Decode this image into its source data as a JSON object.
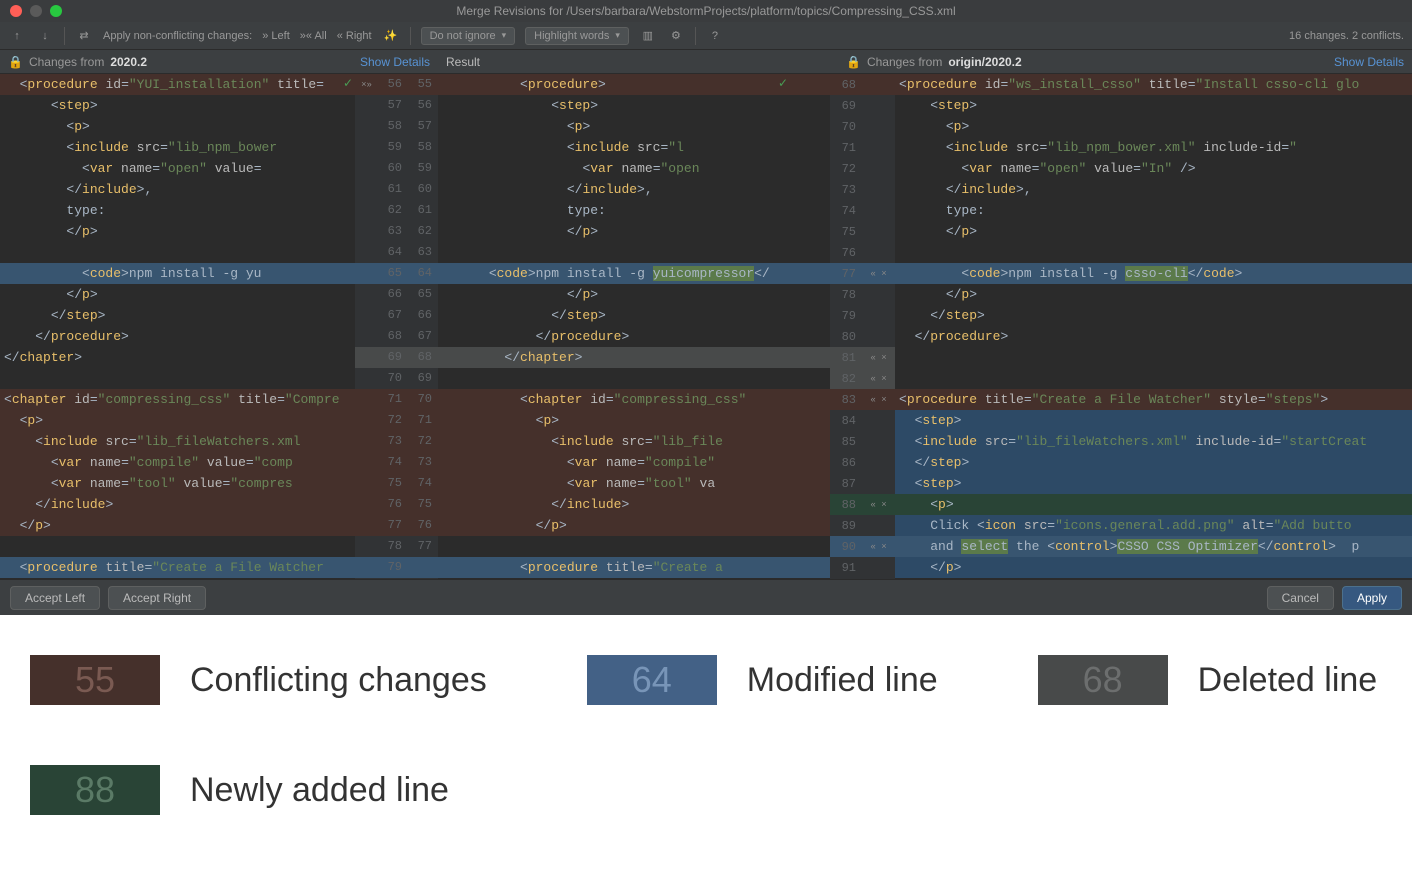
{
  "titlebar": "Merge Revisions for /Users/barbara/WebstormProjects/platform/topics/Compressing_CSS.xml",
  "toolbar": {
    "apply_label": "Apply non-conflicting changes:",
    "left": "Left",
    "all": "All",
    "right": "Right",
    "ignore_dd": "Do not ignore",
    "highlight_dd": "Highlight words",
    "status": "16 changes. 2 conflicts."
  },
  "panels": {
    "left_prefix": "Changes from ",
    "left_bold": "2020.2",
    "mid": "Result",
    "right_prefix": "Changes from ",
    "right_bold": "origin/2020.2",
    "show_details": "Show Details"
  },
  "left_lines": [
    {
      "n": null,
      "cls": "hl-conflict",
      "html": "  <span class='t-punc'>&lt;</span><span class='t-tag'>procedure</span> <span class='t-attr'>id</span>=<span class='t-str'>\"YUI_installation\"</span> <span class='t-attr'>title</span>="
    },
    {
      "n": null,
      "html": "      <span class='t-punc'>&lt;</span><span class='t-tag'>step</span><span class='t-punc'>&gt;</span>"
    },
    {
      "n": null,
      "html": "        <span class='t-punc'>&lt;</span><span class='t-tag'>p</span><span class='t-punc'>&gt;</span>"
    },
    {
      "n": null,
      "html": "        <span class='t-punc'>&lt;</span><span class='t-tag'>include</span> <span class='t-attr'>src</span>=<span class='t-str'>\"lib_npm_bower</span>"
    },
    {
      "n": null,
      "html": "          <span class='t-punc'>&lt;</span><span class='t-tag'>var</span> <span class='t-attr'>name</span>=<span class='t-str'>\"open\"</span> <span class='t-attr'>value</span>="
    },
    {
      "n": null,
      "html": "        <span class='t-punc'>&lt;/</span><span class='t-tag'>include</span><span class='t-punc'>&gt;</span>,"
    },
    {
      "n": null,
      "html": "        type:"
    },
    {
      "n": null,
      "html": "        <span class='t-punc'>&lt;/</span><span class='t-tag'>p</span><span class='t-punc'>&gt;</span>"
    },
    {
      "n": null,
      "html": ""
    },
    {
      "n": null,
      "cls": "hl-mod",
      "html": "          <span class='t-punc'>&lt;</span><span class='t-tag'>code</span><span class='t-punc'>&gt;</span>npm install -g yu"
    },
    {
      "n": null,
      "html": "        <span class='t-punc'>&lt;/</span><span class='t-tag'>p</span><span class='t-punc'>&gt;</span>"
    },
    {
      "n": null,
      "html": "      <span class='t-punc'>&lt;/</span><span class='t-tag'>step</span><span class='t-punc'>&gt;</span>"
    },
    {
      "n": null,
      "html": "    <span class='t-punc'>&lt;/</span><span class='t-tag'>procedure</span><span class='t-punc'>&gt;</span>"
    },
    {
      "n": null,
      "html": "<span class='t-punc'>&lt;/</span><span class='t-tag'>chapter</span><span class='t-punc'>&gt;</span>"
    },
    {
      "n": null,
      "html": ""
    },
    {
      "n": null,
      "cls": "hl-conflict",
      "html": "<span class='t-punc'>&lt;</span><span class='t-tag'>chapter</span> <span class='t-attr'>id</span>=<span class='t-str'>\"compressing_css\"</span> <span class='t-attr'>title</span>=<span class='t-str'>\"Compre</span>"
    },
    {
      "n": null,
      "cls": "hl-conflict",
      "html": "  <span class='t-punc'>&lt;</span><span class='t-tag'>p</span><span class='t-punc'>&gt;</span>"
    },
    {
      "n": null,
      "cls": "hl-conflict",
      "html": "    <span class='t-punc'>&lt;</span><span class='t-tag'>include</span> <span class='t-attr'>src</span>=<span class='t-str'>\"lib_fileWatchers.xml</span>"
    },
    {
      "n": null,
      "cls": "hl-conflict",
      "html": "      <span class='t-punc'>&lt;</span><span class='t-tag'>var</span> <span class='t-attr'>name</span>=<span class='t-str'>\"compile\"</span> <span class='t-attr'>value</span>=<span class='t-str'>\"comp</span>"
    },
    {
      "n": null,
      "cls": "hl-conflict",
      "html": "      <span class='t-punc'>&lt;</span><span class='t-tag'>var</span> <span class='t-attr'>name</span>=<span class='t-str'>\"tool\"</span> <span class='t-attr'>value</span>=<span class='t-str'>\"compres</span>"
    },
    {
      "n": null,
      "cls": "hl-conflict",
      "html": "    <span class='t-punc'>&lt;/</span><span class='t-tag'>include</span><span class='t-punc'>&gt;</span>"
    },
    {
      "n": null,
      "cls": "hl-conflict",
      "html": "  <span class='t-punc'>&lt;/</span><span class='t-tag'>p</span><span class='t-punc'>&gt;</span>"
    },
    {
      "n": null,
      "html": ""
    },
    {
      "n": null,
      "cls": "hl-mod",
      "html": "  <span class='t-punc'>&lt;</span><span class='t-tag'>procedure</span> <span class='t-attr'>title</span>=<span class='t-str'>\"Create a File Watcher</span>"
    }
  ],
  "gutter_pairs": [
    {
      "l": 56,
      "m": 55,
      "cls": "gm-conflict",
      "act": "×»"
    },
    {
      "l": 57,
      "m": 56
    },
    {
      "l": 58,
      "m": 57
    },
    {
      "l": 59,
      "m": 58
    },
    {
      "l": 60,
      "m": 59
    },
    {
      "l": 61,
      "m": 60
    },
    {
      "l": 62,
      "m": 61
    },
    {
      "l": 63,
      "m": 62
    },
    {
      "l": 64,
      "m": 63
    },
    {
      "l": 65,
      "m": 64,
      "cls": "gm-mod"
    },
    {
      "l": 66,
      "m": 65
    },
    {
      "l": 67,
      "m": 66
    },
    {
      "l": 68,
      "m": 67
    },
    {
      "l": 69,
      "m": 68,
      "cls": "gm-del"
    },
    {
      "l": 70,
      "m": 69
    },
    {
      "l": 71,
      "m": 70,
      "cls": "gm-conflict"
    },
    {
      "l": 72,
      "m": 71,
      "cls": "gm-conflict"
    },
    {
      "l": 73,
      "m": 72,
      "cls": "gm-conflict"
    },
    {
      "l": 74,
      "m": 73,
      "cls": "gm-conflict"
    },
    {
      "l": 75,
      "m": 74,
      "cls": "gm-conflict"
    },
    {
      "l": 76,
      "m": 75,
      "cls": "gm-conflict"
    },
    {
      "l": 77,
      "m": 76,
      "cls": "gm-conflict"
    },
    {
      "l": 78,
      "m": 77
    },
    {
      "l": 79,
      "m": "",
      "cls": "gm-mod"
    }
  ],
  "mid_lines": [
    {
      "cls": "hl-conflict",
      "html": "          <span class='t-punc'>&lt;</span><span class='t-tag'>procedure</span><span class='t-punc'>&gt;</span>"
    },
    {
      "html": "              <span class='t-punc'>&lt;</span><span class='t-tag'>step</span><span class='t-punc'>&gt;</span>"
    },
    {
      "html": "                <span class='t-punc'>&lt;</span><span class='t-tag'>p</span><span class='t-punc'>&gt;</span>"
    },
    {
      "html": "                <span class='t-punc'>&lt;</span><span class='t-tag'>include</span> <span class='t-attr'>src</span>=<span class='t-str'>\"l</span>"
    },
    {
      "html": "                  <span class='t-punc'>&lt;</span><span class='t-tag'>var</span> <span class='t-attr'>name</span>=<span class='t-str'>\"open</span>"
    },
    {
      "html": "                <span class='t-punc'>&lt;/</span><span class='t-tag'>include</span><span class='t-punc'>&gt;</span>,"
    },
    {
      "html": "                type:"
    },
    {
      "html": "                <span class='t-punc'>&lt;/</span><span class='t-tag'>p</span><span class='t-punc'>&gt;</span>"
    },
    {
      "html": ""
    },
    {
      "cls": "hl-mod",
      "html": "      <span class='t-punc'>&lt;</span><span class='t-tag'>code</span><span class='t-punc'>&gt;</span>npm install -g <span class='hlword'>yuicompressor</span><span class='t-punc'>&lt;/</span>"
    },
    {
      "html": "                <span class='t-punc'>&lt;/</span><span class='t-tag'>p</span><span class='t-punc'>&gt;</span>"
    },
    {
      "html": "              <span class='t-punc'>&lt;/</span><span class='t-tag'>step</span><span class='t-punc'>&gt;</span>"
    },
    {
      "html": "            <span class='t-punc'>&lt;/</span><span class='t-tag'>procedure</span><span class='t-punc'>&gt;</span>"
    },
    {
      "cls": "hl-del",
      "html": "        <span class='t-punc'>&lt;/</span><span class='t-tag'>chapter</span><span class='t-punc'>&gt;</span>"
    },
    {
      "html": ""
    },
    {
      "cls": "hl-conflict",
      "html": "          <span class='t-punc'>&lt;</span><span class='t-tag'>chapter</span> <span class='t-attr'>id</span>=<span class='t-str'>\"compressing_css\"</span>"
    },
    {
      "cls": "hl-conflict",
      "html": "            <span class='t-punc'>&lt;</span><span class='t-tag'>p</span><span class='t-punc'>&gt;</span>"
    },
    {
      "cls": "hl-conflict",
      "html": "              <span class='t-punc'>&lt;</span><span class='t-tag'>include</span> <span class='t-attr'>src</span>=<span class='t-str'>\"lib_file</span>"
    },
    {
      "cls": "hl-conflict",
      "html": "                <span class='t-punc'>&lt;</span><span class='t-tag'>var</span> <span class='t-attr'>name</span>=<span class='t-str'>\"compile\"</span>"
    },
    {
      "cls": "hl-conflict",
      "html": "                <span class='t-punc'>&lt;</span><span class='t-tag'>var</span> <span class='t-attr'>name</span>=<span class='t-str'>\"tool\"</span> <span class='t-attr'>va</span>"
    },
    {
      "cls": "hl-conflict",
      "html": "              <span class='t-punc'>&lt;/</span><span class='t-tag'>include</span><span class='t-punc'>&gt;</span>"
    },
    {
      "cls": "hl-conflict",
      "html": "            <span class='t-punc'>&lt;/</span><span class='t-tag'>p</span><span class='t-punc'>&gt;</span>"
    },
    {
      "html": ""
    },
    {
      "cls": "hl-mod",
      "html": "          <span class='t-punc'>&lt;</span><span class='t-tag'>procedure</span> <span class='t-attr'>title</span>=<span class='t-str'>\"Create a</span>"
    }
  ],
  "right_gut": [
    {
      "n": 68,
      "cls": "gm-conflict"
    },
    {
      "n": 69
    },
    {
      "n": 70
    },
    {
      "n": 71
    },
    {
      "n": 72
    },
    {
      "n": 73
    },
    {
      "n": 74
    },
    {
      "n": 75
    },
    {
      "n": 76
    },
    {
      "n": 77,
      "cls": "gm-mod",
      "act": "« ×"
    },
    {
      "n": 78
    },
    {
      "n": 79
    },
    {
      "n": 80
    },
    {
      "n": 81,
      "cls": "gm-del",
      "act": "« ×"
    },
    {
      "n": 82,
      "cls": "gm-del",
      "act": "« ×"
    },
    {
      "n": 83,
      "cls": "gm-conflict",
      "act": "« ×"
    },
    {
      "n": 84,
      "cls": "gm-mod2"
    },
    {
      "n": 85,
      "cls": "gm-mod2"
    },
    {
      "n": 86,
      "cls": "gm-mod2"
    },
    {
      "n": 87,
      "cls": "gm-mod2"
    },
    {
      "n": 88,
      "cls": "gm-add",
      "act": "« ×"
    },
    {
      "n": 89,
      "cls": "gm-mod2"
    },
    {
      "n": 90,
      "cls": "gm-mod",
      "act": "« ×"
    },
    {
      "n": 91,
      "cls": "gm-mod2"
    }
  ],
  "right_lines": [
    {
      "cls": "hl-conflict",
      "html": "<span class='t-punc'>&lt;</span><span class='t-tag'>procedure</span> <span class='t-attr'>id</span>=<span class='t-str'>\"ws_install_csso\"</span> <span class='t-attr'>title</span>=<span class='t-str'>\"Install csso-cli glo</span>"
    },
    {
      "html": "    <span class='t-punc'>&lt;</span><span class='t-tag'>step</span><span class='t-punc'>&gt;</span>"
    },
    {
      "html": "      <span class='t-punc'>&lt;</span><span class='t-tag'>p</span><span class='t-punc'>&gt;</span>"
    },
    {
      "html": "      <span class='t-punc'>&lt;</span><span class='t-tag'>include</span> <span class='t-attr'>src</span>=<span class='t-str'>\"lib_npm_bower.xml\"</span> <span class='t-attr'>include-id</span>=<span class='t-str'>\"</span>"
    },
    {
      "html": "        <span class='t-punc'>&lt;</span><span class='t-tag'>var</span> <span class='t-attr'>name</span>=<span class='t-str'>\"open\"</span> <span class='t-attr'>value</span>=<span class='t-str'>\"In\"</span> /&gt;"
    },
    {
      "html": "      <span class='t-punc'>&lt;/</span><span class='t-tag'>include</span><span class='t-punc'>&gt;</span>,"
    },
    {
      "html": "      type:"
    },
    {
      "html": "      <span class='t-punc'>&lt;/</span><span class='t-tag'>p</span><span class='t-punc'>&gt;</span>"
    },
    {
      "html": ""
    },
    {
      "cls": "hl-mod",
      "html": "        <span class='t-punc'>&lt;</span><span class='t-tag'>code</span><span class='t-punc'>&gt;</span>npm install -g <span class='hlword'>csso-cli</span><span class='t-punc'>&lt;/</span><span class='t-tag'>code</span><span class='t-punc'>&gt;</span>"
    },
    {
      "html": "      <span class='t-punc'>&lt;/</span><span class='t-tag'>p</span><span class='t-punc'>&gt;</span>"
    },
    {
      "html": "    <span class='t-punc'>&lt;/</span><span class='t-tag'>step</span><span class='t-punc'>&gt;</span>"
    },
    {
      "html": "  <span class='t-punc'>&lt;/</span><span class='t-tag'>procedure</span><span class='t-punc'>&gt;</span>"
    },
    {
      "html": ""
    },
    {
      "html": ""
    },
    {
      "cls": "hl-conflict",
      "html": "<span class='t-punc'>&lt;</span><span class='t-tag'>procedure</span> <span class='t-attr'>title</span>=<span class='t-str'>\"Create a File Watcher\"</span> <span class='t-attr'>style</span>=<span class='t-str'>\"steps\"</span><span class='t-punc'>&gt;</span>"
    },
    {
      "cls": "hl-mod2",
      "html": "  <span class='t-punc'>&lt;</span><span class='t-tag'>step</span><span class='t-punc'>&gt;</span>"
    },
    {
      "cls": "hl-mod2",
      "html": "  <span class='t-punc'>&lt;</span><span class='t-tag'>include</span> <span class='t-attr'>src</span>=<span class='t-str'>\"lib_fileWatchers.xml\"</span> <span class='t-attr'>include-id</span>=<span class='t-str'>\"startCreat</span>"
    },
    {
      "cls": "hl-mod2",
      "html": "  <span class='t-punc'>&lt;/</span><span class='t-tag'>step</span><span class='t-punc'>&gt;</span>"
    },
    {
      "cls": "hl-mod2",
      "html": "  <span class='t-punc'>&lt;</span><span class='t-tag'>step</span><span class='t-punc'>&gt;</span>"
    },
    {
      "cls": "hl-add",
      "html": "    <span class='t-punc'>&lt;</span><span class='t-tag'>p</span><span class='t-punc'>&gt;</span>"
    },
    {
      "cls": "hl-mod2",
      "html": "    Click <span class='t-punc'>&lt;</span><span class='t-tag'>icon</span> <span class='t-attr'>src</span>=<span class='t-str'>\"icons.general.add.png\"</span> <span class='t-attr'>alt</span>=<span class='t-str'>\"Add butto</span>"
    },
    {
      "cls": "hl-mod",
      "html": "    and <span class='hlword'>select</span> the <span class='t-punc'>&lt;</span><span class='t-tag'>control</span><span class='t-punc'>&gt;</span><span class='hlword'>CSSO CSS Optimizer</span><span class='t-punc'>&lt;/</span><span class='t-tag'>control</span><span class='t-punc'>&gt;</span>  p"
    },
    {
      "cls": "hl-mod2",
      "html": "    <span class='t-punc'>&lt;/</span><span class='t-tag'>p</span><span class='t-punc'>&gt;</span>"
    }
  ],
  "footer": {
    "accept_left": "Accept Left",
    "accept_right": "Accept Right",
    "cancel": "Cancel",
    "apply": "Apply"
  },
  "legend": {
    "conflict_n": "55",
    "conflict_t": "Conflicting changes",
    "modified_n": "64",
    "modified_t": "Modified line",
    "deleted_n": "68",
    "deleted_t": "Deleted line",
    "added_n": "88",
    "added_t": "Newly added line"
  }
}
